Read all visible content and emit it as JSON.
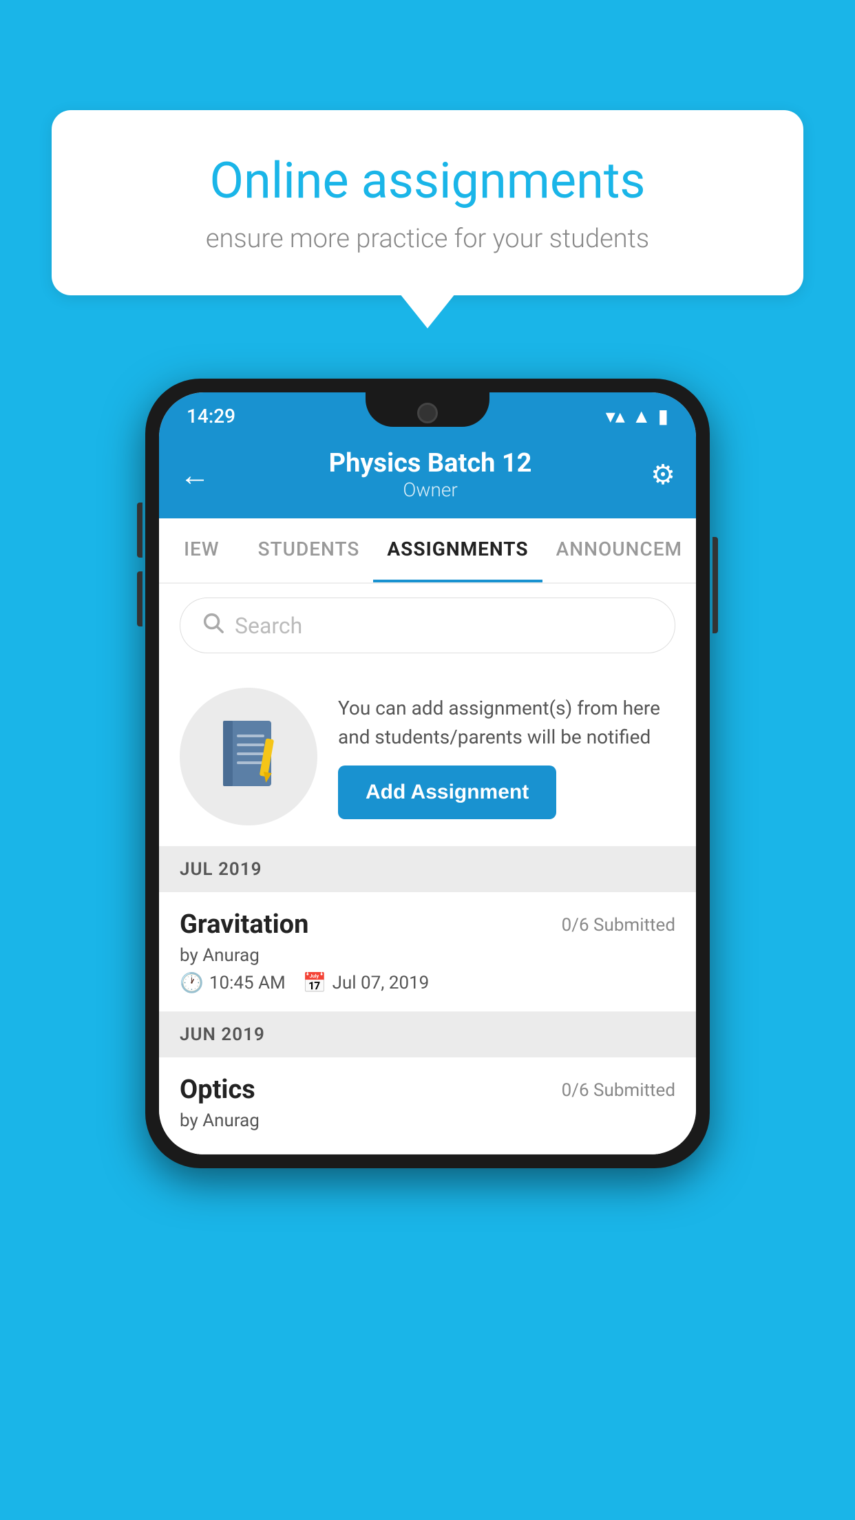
{
  "background_color": "#1ab5e8",
  "speech_bubble": {
    "title": "Online assignments",
    "subtitle": "ensure more practice for your students"
  },
  "phone": {
    "status_bar": {
      "time": "14:29"
    },
    "header": {
      "title": "Physics Batch 12",
      "subtitle": "Owner",
      "back_label": "←",
      "settings_label": "⚙"
    },
    "tabs": [
      {
        "label": "IEW",
        "active": false
      },
      {
        "label": "STUDENTS",
        "active": false
      },
      {
        "label": "ASSIGNMENTS",
        "active": true
      },
      {
        "label": "ANNOUNCEM",
        "active": false
      }
    ],
    "search": {
      "placeholder": "Search"
    },
    "promo": {
      "text": "You can add assignment(s) from here and students/parents will be notified",
      "button_label": "Add Assignment"
    },
    "sections": [
      {
        "month_label": "JUL 2019",
        "assignments": [
          {
            "name": "Gravitation",
            "submitted": "0/6 Submitted",
            "by": "by Anurag",
            "time": "10:45 AM",
            "date": "Jul 07, 2019"
          }
        ]
      },
      {
        "month_label": "JUN 2019",
        "assignments": [
          {
            "name": "Optics",
            "submitted": "0/6 Submitted",
            "by": "by Anurag",
            "time": "",
            "date": ""
          }
        ]
      }
    ]
  }
}
